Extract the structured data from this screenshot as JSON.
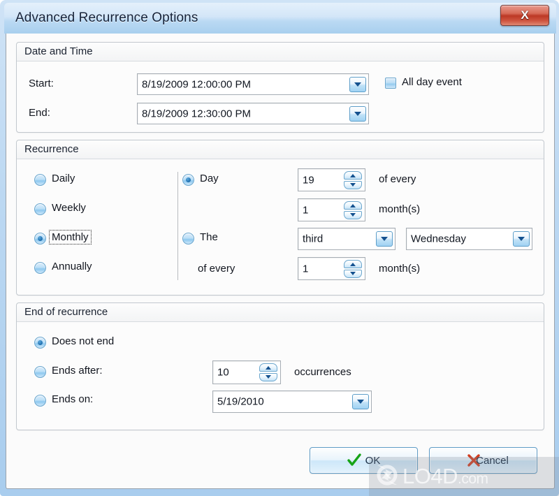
{
  "window": {
    "title": "Advanced Recurrence Options",
    "close_label": "X",
    "close_icon": "close-icon",
    "accent_color": "#a8cfee",
    "close_color": "#bc3925"
  },
  "date_time": {
    "group_title": "Date and Time",
    "start_label": "Start:",
    "start_value": "8/19/2009 12:00:00 PM",
    "end_label": "End:",
    "end_value": "8/19/2009 12:30:00 PM",
    "all_day_label": "All day event",
    "all_day_checked": false
  },
  "recurrence": {
    "group_title": "Recurrence",
    "frequency": [
      {
        "label": "Daily",
        "checked": false
      },
      {
        "label": "Weekly",
        "checked": false
      },
      {
        "label": "Monthly",
        "checked": true,
        "focused": true
      },
      {
        "label": "Annually",
        "checked": false
      }
    ],
    "day_radio_label": "Day",
    "day_radio_checked": true,
    "day_of_month": "19",
    "of_every_label": "of every",
    "day_interval": "1",
    "day_months_label": "month(s)",
    "the_radio_label": "The",
    "the_radio_checked": false,
    "ordinal_value": "third",
    "weekday_value": "Wednesday",
    "the_of_every_label": "of every",
    "the_interval": "1",
    "the_months_label": "month(s)"
  },
  "end_of_recurrence": {
    "group_title": "End of recurrence",
    "does_not_end_label": "Does not end",
    "does_not_end_checked": true,
    "ends_after_label": "Ends after:",
    "ends_after_checked": false,
    "occurrences_value": "10",
    "occurrences_label": "occurrences",
    "ends_on_label": "Ends on:",
    "ends_on_checked": false,
    "ends_on_value": "5/19/2010"
  },
  "footer": {
    "ok_label": "OK",
    "ok_icon": "check-icon",
    "cancel_label": "Cancel",
    "cancel_icon": "cross-icon"
  },
  "watermark": {
    "text": "LO4D",
    "suffix": ".com",
    "logo_icon": "refresh-circle-icon"
  }
}
